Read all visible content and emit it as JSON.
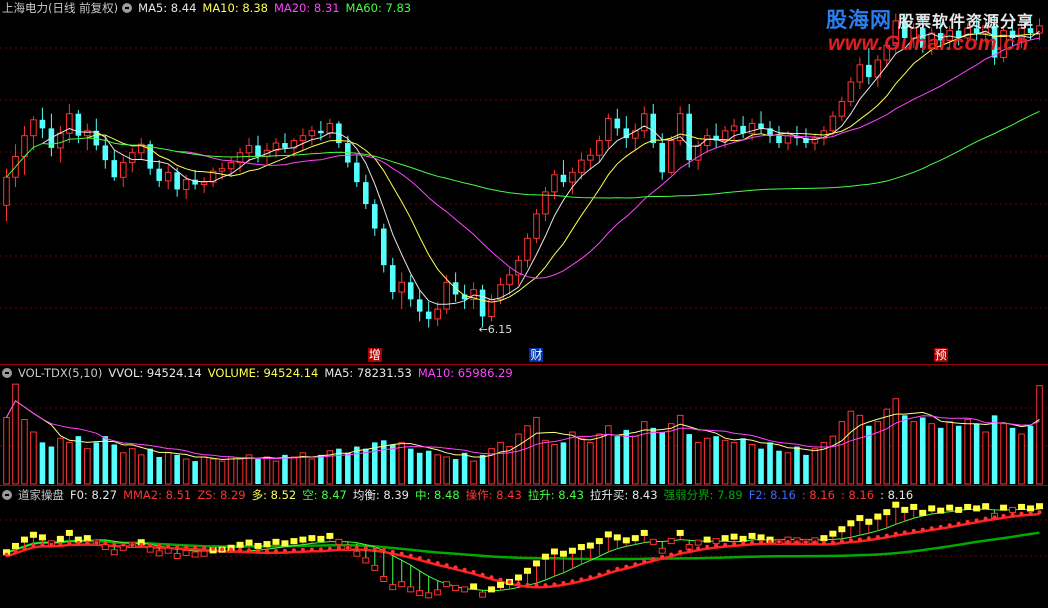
{
  "main_header": {
    "title": "上海电力(日线 前复权)",
    "items": [
      {
        "text": "MA5: 8.44",
        "color": "#e8e8e8"
      },
      {
        "text": "MA10: 8.38",
        "color": "#ffff55"
      },
      {
        "text": "MA20: 8.31",
        "color": "#ff44ff"
      },
      {
        "text": "MA60: 7.83",
        "color": "#44ff44"
      }
    ]
  },
  "vol_header": {
    "title": "VOL-TDX(5,10)",
    "items": [
      {
        "text": "VVOL: 94524.14",
        "color": "#e8e8e8"
      },
      {
        "text": "VOLUME: 94524.14",
        "color": "#ffff55"
      },
      {
        "text": "MA5: 78231.53",
        "color": "#e8e8e8"
      },
      {
        "text": "MA10: 65986.29",
        "color": "#ff44ff"
      }
    ]
  },
  "ind_header": {
    "title": "道家操盘",
    "items": [
      {
        "text": "F0: 8.27",
        "color": "#e8e8e8"
      },
      {
        "text": "MMA2: 8.51",
        "color": "#ff3333"
      },
      {
        "text": "ZS: 8.29",
        "color": "#ff3333"
      },
      {
        "text": "多: 8.52",
        "color": "#ffff55"
      },
      {
        "text": "空: 8.47",
        "color": "#44ff44"
      },
      {
        "text": "均衡: 8.39",
        "color": "#e8e8e8"
      },
      {
        "text": "中: 8.48",
        "color": "#44ff44"
      },
      {
        "text": "操作: 8.43",
        "color": "#ff3333"
      },
      {
        "text": "拉升: 8.43",
        "color": "#44ff44"
      },
      {
        "text": "拉升买: 8.43",
        "color": "#e8e8e8"
      },
      {
        "text": "强弱分界: 7.89",
        "color": "#00aa00"
      },
      {
        "text": "F2: 8.16",
        "color": "#4466ff"
      },
      {
        "text": ": 8.16",
        "color": "#ff3333"
      },
      {
        "text": ": 8.16",
        "color": "#ff3333"
      },
      {
        "text": ": 8.16",
        "color": "#e8e8e8"
      }
    ]
  },
  "logo": {
    "cn": "股海网",
    "sub": "股票软件资源分享",
    "url": "www.Guhai.com.cn"
  },
  "markers": [
    {
      "text": "增",
      "bar": 41,
      "color": "#ffffff",
      "bg": "#aa0000"
    },
    {
      "text": "财",
      "bar": 59,
      "color": "#ffffff",
      "bg": "#0033aa"
    },
    {
      "text": "预",
      "bar": 104,
      "color": "#ffffff",
      "bg": "#aa0000"
    }
  ],
  "low_label": {
    "text": "6.15",
    "bar": 53
  },
  "colors": {
    "up": "#ff3333",
    "down": "#54ffff",
    "bg": "#000000",
    "grid": "#7a0000"
  },
  "chart_data": {
    "type": "candlestick",
    "y_range": [
      5.9,
      8.7
    ],
    "ma_periods": [
      5,
      10,
      20,
      60
    ],
    "ma_colors": [
      "#e8e8e8",
      "#ffff55",
      "#ff44ff",
      "#44ff44"
    ],
    "ohlc": [
      [
        7.15,
        7.45,
        7.02,
        7.38
      ],
      [
        7.38,
        7.65,
        7.3,
        7.55
      ],
      [
        7.55,
        7.8,
        7.4,
        7.72
      ],
      [
        7.72,
        7.88,
        7.6,
        7.85
      ],
      [
        7.85,
        7.95,
        7.7,
        7.78
      ],
      [
        7.78,
        7.9,
        7.55,
        7.62
      ],
      [
        7.62,
        7.8,
        7.5,
        7.74
      ],
      [
        7.74,
        7.98,
        7.66,
        7.9
      ],
      [
        7.9,
        7.93,
        7.66,
        7.72
      ],
      [
        7.72,
        7.82,
        7.6,
        7.76
      ],
      [
        7.76,
        7.86,
        7.6,
        7.64
      ],
      [
        7.64,
        7.72,
        7.45,
        7.52
      ],
      [
        7.52,
        7.6,
        7.35,
        7.38
      ],
      [
        7.38,
        7.55,
        7.3,
        7.5
      ],
      [
        7.5,
        7.62,
        7.42,
        7.58
      ],
      [
        7.58,
        7.7,
        7.52,
        7.65
      ],
      [
        7.65,
        7.68,
        7.4,
        7.45
      ],
      [
        7.45,
        7.52,
        7.3,
        7.35
      ],
      [
        7.35,
        7.48,
        7.28,
        7.42
      ],
      [
        7.42,
        7.46,
        7.22,
        7.28
      ],
      [
        7.28,
        7.4,
        7.2,
        7.36
      ],
      [
        7.36,
        7.44,
        7.28,
        7.32
      ],
      [
        7.32,
        7.38,
        7.25,
        7.34
      ],
      [
        7.34,
        7.46,
        7.3,
        7.43
      ],
      [
        7.43,
        7.5,
        7.36,
        7.45
      ],
      [
        7.45,
        7.55,
        7.38,
        7.5
      ],
      [
        7.5,
        7.62,
        7.42,
        7.58
      ],
      [
        7.58,
        7.7,
        7.5,
        7.64
      ],
      [
        7.64,
        7.72,
        7.5,
        7.55
      ],
      [
        7.55,
        7.66,
        7.48,
        7.6
      ],
      [
        7.6,
        7.7,
        7.54,
        7.66
      ],
      [
        7.66,
        7.74,
        7.58,
        7.62
      ],
      [
        7.62,
        7.7,
        7.55,
        7.68
      ],
      [
        7.68,
        7.78,
        7.6,
        7.72
      ],
      [
        7.72,
        7.8,
        7.64,
        7.76
      ],
      [
        7.76,
        7.84,
        7.68,
        7.74
      ],
      [
        7.74,
        7.86,
        7.7,
        7.82
      ],
      [
        7.82,
        7.84,
        7.62,
        7.66
      ],
      [
        7.66,
        7.72,
        7.46,
        7.5
      ],
      [
        7.5,
        7.56,
        7.3,
        7.34
      ],
      [
        7.34,
        7.4,
        7.12,
        7.16
      ],
      [
        7.16,
        7.2,
        6.9,
        6.96
      ],
      [
        6.96,
        7.0,
        6.6,
        6.66
      ],
      [
        6.66,
        6.72,
        6.38,
        6.44
      ],
      [
        6.44,
        6.6,
        6.3,
        6.52
      ],
      [
        6.52,
        6.58,
        6.32,
        6.38
      ],
      [
        6.38,
        6.45,
        6.2,
        6.28
      ],
      [
        6.28,
        6.36,
        6.15,
        6.22
      ],
      [
        6.22,
        6.36,
        6.16,
        6.3
      ],
      [
        6.3,
        6.58,
        6.26,
        6.52
      ],
      [
        6.52,
        6.6,
        6.36,
        6.42
      ],
      [
        6.42,
        6.5,
        6.3,
        6.38
      ],
      [
        6.38,
        6.52,
        6.3,
        6.46
      ],
      [
        6.46,
        6.5,
        6.15,
        6.24
      ],
      [
        6.24,
        6.42,
        6.2,
        6.38
      ],
      [
        6.38,
        6.56,
        6.34,
        6.5
      ],
      [
        6.5,
        6.64,
        6.42,
        6.58
      ],
      [
        6.58,
        6.74,
        6.5,
        6.7
      ],
      [
        6.7,
        6.92,
        6.64,
        6.88
      ],
      [
        6.88,
        7.12,
        6.84,
        7.08
      ],
      [
        7.08,
        7.3,
        7.02,
        7.26
      ],
      [
        7.26,
        7.44,
        7.2,
        7.4
      ],
      [
        7.4,
        7.52,
        7.3,
        7.34
      ],
      [
        7.34,
        7.46,
        7.24,
        7.42
      ],
      [
        7.42,
        7.58,
        7.36,
        7.52
      ],
      [
        7.52,
        7.62,
        7.44,
        7.56
      ],
      [
        7.56,
        7.72,
        7.5,
        7.68
      ],
      [
        7.68,
        7.9,
        7.62,
        7.86
      ],
      [
        7.86,
        7.94,
        7.72,
        7.78
      ],
      [
        7.78,
        7.88,
        7.62,
        7.7
      ],
      [
        7.7,
        7.82,
        7.6,
        7.76
      ],
      [
        7.76,
        7.96,
        7.7,
        7.9
      ],
      [
        7.9,
        7.98,
        7.62,
        7.66
      ],
      [
        7.66,
        7.74,
        7.36,
        7.42
      ],
      [
        7.42,
        7.72,
        7.4,
        7.68
      ],
      [
        7.68,
        7.96,
        7.64,
        7.9
      ],
      [
        7.9,
        7.98,
        7.46,
        7.52
      ],
      [
        7.52,
        7.68,
        7.44,
        7.64
      ],
      [
        7.64,
        7.78,
        7.58,
        7.72
      ],
      [
        7.72,
        7.82,
        7.62,
        7.68
      ],
      [
        7.68,
        7.8,
        7.62,
        7.76
      ],
      [
        7.76,
        7.86,
        7.68,
        7.8
      ],
      [
        7.8,
        7.88,
        7.7,
        7.74
      ],
      [
        7.74,
        7.86,
        7.68,
        7.82
      ],
      [
        7.82,
        7.92,
        7.74,
        7.78
      ],
      [
        7.78,
        7.84,
        7.66,
        7.72
      ],
      [
        7.72,
        7.8,
        7.62,
        7.66
      ],
      [
        7.66,
        7.76,
        7.6,
        7.72
      ],
      [
        7.72,
        7.8,
        7.64,
        7.7
      ],
      [
        7.7,
        7.78,
        7.62,
        7.66
      ],
      [
        7.66,
        7.74,
        7.6,
        7.7
      ],
      [
        7.7,
        7.8,
        7.64,
        7.76
      ],
      [
        7.76,
        7.92,
        7.72,
        7.88
      ],
      [
        7.88,
        8.04,
        7.84,
        8.0
      ],
      [
        8.0,
        8.2,
        7.96,
        8.16
      ],
      [
        8.16,
        8.36,
        8.1,
        8.3
      ],
      [
        8.3,
        8.44,
        8.14,
        8.2
      ],
      [
        8.2,
        8.38,
        8.12,
        8.34
      ],
      [
        8.34,
        8.5,
        8.28,
        8.46
      ],
      [
        8.46,
        8.72,
        8.4,
        8.66
      ],
      [
        8.66,
        8.72,
        8.48,
        8.52
      ],
      [
        8.52,
        8.64,
        8.44,
        8.6
      ],
      [
        8.6,
        8.7,
        8.4,
        8.44
      ],
      [
        8.44,
        8.6,
        8.38,
        8.56
      ],
      [
        8.56,
        8.68,
        8.44,
        8.5
      ],
      [
        8.5,
        8.62,
        8.42,
        8.58
      ],
      [
        8.58,
        8.66,
        8.46,
        8.52
      ],
      [
        8.52,
        8.64,
        8.46,
        8.6
      ],
      [
        8.6,
        8.7,
        8.5,
        8.56
      ],
      [
        8.56,
        8.68,
        8.48,
        8.62
      ],
      [
        8.62,
        8.7,
        8.3,
        8.36
      ],
      [
        8.36,
        8.62,
        8.32,
        8.58
      ],
      [
        8.58,
        8.7,
        8.46,
        8.52
      ],
      [
        8.52,
        8.64,
        8.44,
        8.6
      ],
      [
        8.6,
        8.7,
        8.5,
        8.56
      ],
      [
        8.56,
        8.68,
        8.5,
        8.62
      ]
    ],
    "volume": [
      64000,
      96000,
      62000,
      50000,
      40000,
      36000,
      44000,
      40000,
      46000,
      34000,
      40000,
      46000,
      38000,
      30000,
      34000,
      28000,
      34000,
      26000,
      30000,
      28000,
      24000,
      22000,
      26000,
      24000,
      22000,
      26000,
      24000,
      28000,
      24000,
      26000,
      22000,
      28000,
      26000,
      30000,
      24000,
      28000,
      32000,
      34000,
      30000,
      36000,
      34000,
      40000,
      42000,
      38000,
      40000,
      34000,
      30000,
      32000,
      28000,
      26000,
      24000,
      30000,
      22000,
      28000,
      34000,
      40000,
      36000,
      48000,
      56000,
      64000,
      42000,
      38000,
      40000,
      50000,
      44000,
      40000,
      48000,
      56000,
      46000,
      52000,
      46000,
      60000,
      54000,
      50000,
      58000,
      66000,
      48000,
      40000,
      44000,
      46000,
      42000,
      40000,
      44000,
      38000,
      34000,
      40000,
      32000,
      30000,
      36000,
      28000,
      34000,
      40000,
      46000,
      60000,
      70000,
      66000,
      56000,
      60000,
      72000,
      82000,
      66000,
      60000,
      64000,
      58000,
      54000,
      60000,
      56000,
      62000,
      58000,
      50000,
      66000,
      58000,
      54000,
      48000,
      56000,
      94524
    ],
    "vol_max": 100000
  }
}
